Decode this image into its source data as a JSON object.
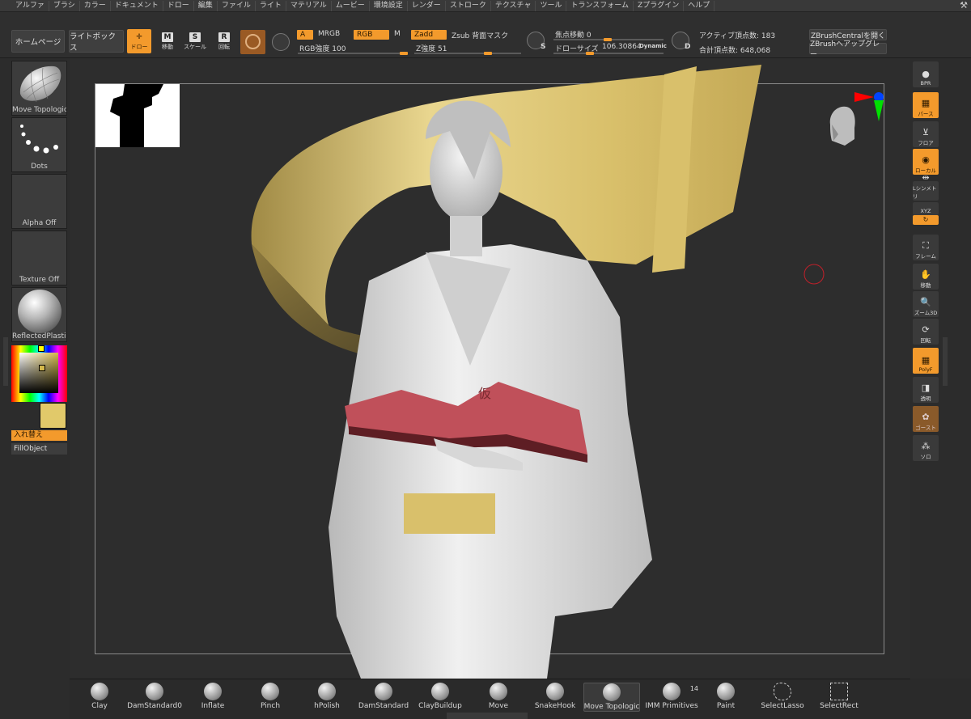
{
  "menu": [
    "アルファ",
    "ブラシ",
    "カラー",
    "ドキュメント",
    "ドロー",
    "編集",
    "ファイル",
    "ライト",
    "マテリアル",
    "ムービー",
    "環境設定",
    "レンダー",
    "ストローク",
    "テクスチャ",
    "ツール",
    "トランスフォーム",
    "Zプラグイン",
    "ヘルプ"
  ],
  "toolbar": {
    "home": "ホームページ",
    "lightbox": "ライトボックス",
    "draw": "ドロー",
    "move": "移動",
    "scale": "スケール",
    "rotate": "回転",
    "glyph_m": "M",
    "glyph_s": "S",
    "glyph_r": "R",
    "chip_a": "A",
    "mrgb": "MRGB",
    "rgb": "RGB",
    "m": "M",
    "zadd": "Zadd",
    "zsub": "Zsub 背面マスク",
    "rgb_intensity": "RGB強度 100",
    "z_intensity": "Z強度 51",
    "focal_shift": "焦点移動 0",
    "draw_size_label": "ドローサイズ",
    "draw_size_value": "106.30864",
    "dynamic": "Dynamic",
    "active_points": "アクティブ頂点数: 183",
    "total_points": "合計頂点数: 648,068",
    "zbc_open": "ZBrushCentralを開く",
    "zbc_upgrade": "ZBrushへアップグレー",
    "s_label": "S",
    "d_label": "D"
  },
  "left": {
    "brush_label": "Move Topologic",
    "stroke_label": "Dots",
    "alpha_label": "Alpha Off",
    "texture_label": "Texture Off",
    "material_label": "ReflectedPlastic",
    "swap_label": "入れ替え",
    "fill_label": "FillObject",
    "swatch_color": "#e1c96a"
  },
  "right": {
    "bpr": "BPR",
    "perspective": "パース",
    "floor": "フロア",
    "local": "ローカル",
    "symmetry": "Lシンメトリ",
    "xyz": "XYZ",
    "frame": "フレーム",
    "move": "移動",
    "zoom": "ズーム3D",
    "rotate": "回転",
    "polyf": "PolyF",
    "transp": "透明",
    "ghost": "ゴースト",
    "solo": "ソロ"
  },
  "brushes": [
    {
      "name": "Clay"
    },
    {
      "name": "DamStandard0"
    },
    {
      "name": "Inflate"
    },
    {
      "name": "Pinch"
    },
    {
      "name": "hPolish"
    },
    {
      "name": "DamStandard"
    },
    {
      "name": "ClayBuildup"
    },
    {
      "name": "Move"
    },
    {
      "name": "SnakeHook"
    },
    {
      "name": "Move Topologic"
    },
    {
      "name": "IMM Primitives",
      "count": "14"
    },
    {
      "name": "Paint"
    },
    {
      "name": "SelectLasso"
    },
    {
      "name": "SelectRect"
    }
  ],
  "canvas": {
    "book_glyph": "仮",
    "model_color": "#dcdcdc",
    "accent_color": "#e1c96a",
    "book_color": "#c0505a"
  }
}
